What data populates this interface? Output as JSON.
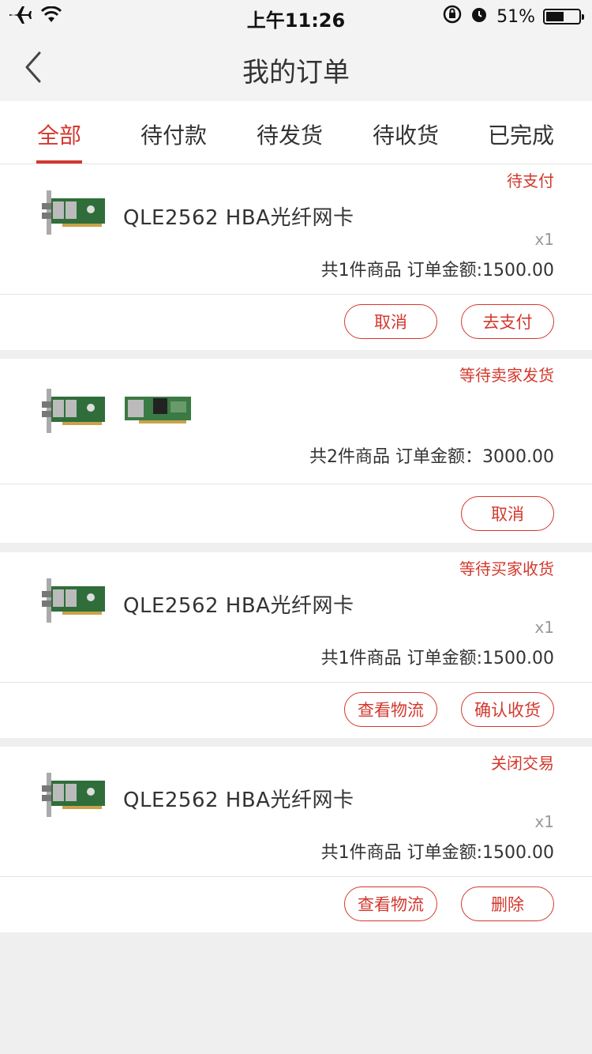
{
  "status_bar": {
    "time": "上午11:26",
    "battery": "51%",
    "battery_level": 0.51,
    "icons": [
      "airplane-icon",
      "wifi-icon",
      "rotation-lock-icon",
      "alarm-icon",
      "battery-icon"
    ]
  },
  "nav": {
    "title": "我的订单",
    "back_icon": "chevron-left-icon"
  },
  "tabs": [
    {
      "label": "全部",
      "active": true
    },
    {
      "label": "待付款",
      "active": false
    },
    {
      "label": "待发货",
      "active": false
    },
    {
      "label": "待收货",
      "active": false
    },
    {
      "label": "已完成",
      "active": false
    }
  ],
  "colors": {
    "accent": "#d3382e",
    "background": "#efeff0",
    "card": "#ffffff",
    "pcb_green": "#2f6e3a"
  },
  "orders": [
    {
      "status": "待支付",
      "product_name": "QLE2562 HBA光纤网卡",
      "quantity": "x1",
      "summary": "共1件商品 订单金额:1500.00",
      "buttons": [
        "取消",
        "去支付"
      ]
    },
    {
      "status": "等待卖家发货",
      "summary": "共2件商品 订单金额：3000.00",
      "buttons": [
        "取消"
      ]
    },
    {
      "status": "等待买家收货",
      "product_name": "QLE2562 HBA光纤网卡",
      "quantity": "x1",
      "summary": "共1件商品 订单金额:1500.00",
      "buttons": [
        "查看物流",
        "确认收货"
      ]
    },
    {
      "status": "关闭交易",
      "product_name": "QLE2562 HBA光纤网卡",
      "quantity": "x1",
      "summary": "共1件商品 订单金额:1500.00",
      "buttons": [
        "查看物流",
        "删除"
      ]
    }
  ]
}
